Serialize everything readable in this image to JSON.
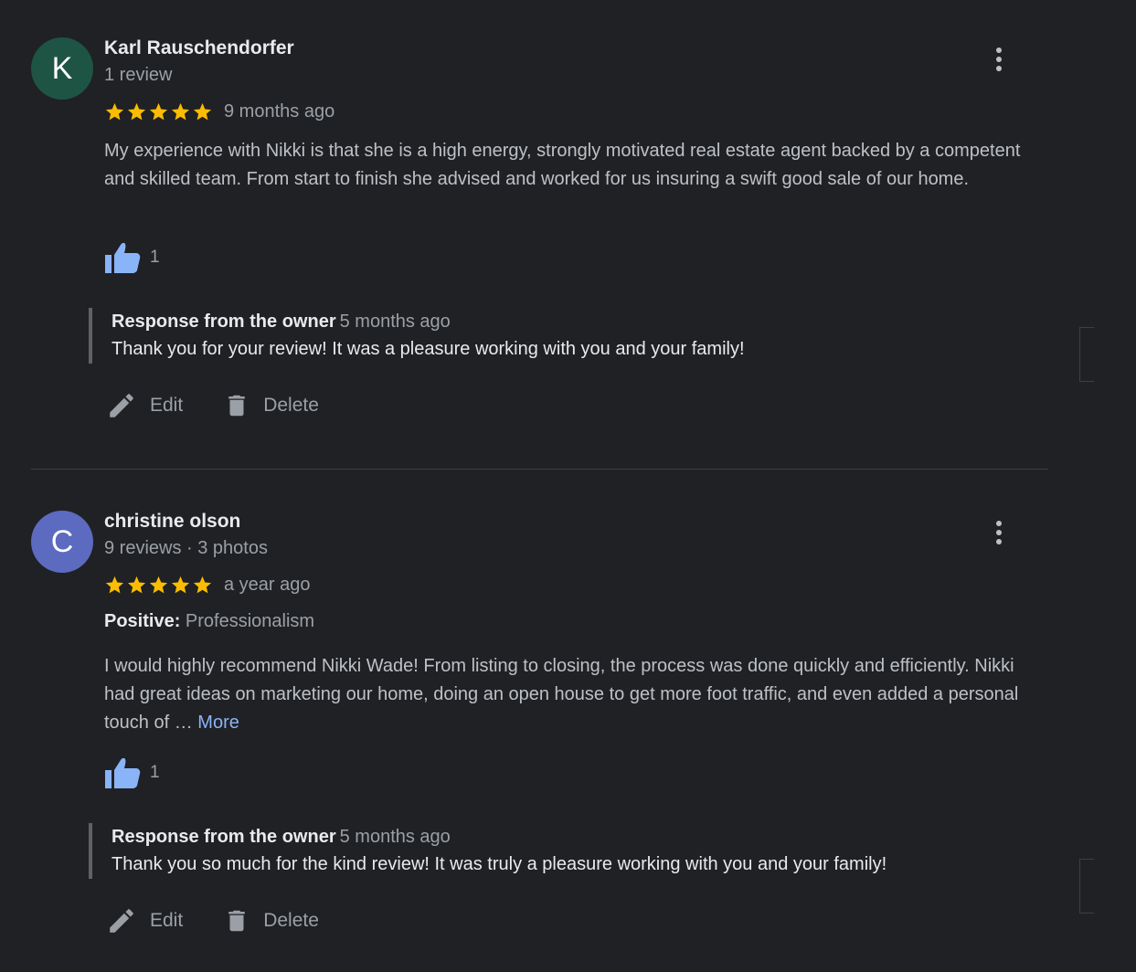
{
  "colors": {
    "background": "#202124",
    "star": "#fbbc04",
    "like": "#8ab4f8",
    "link": "#8ab4f8",
    "avatar_k": "#1e5443",
    "avatar_c": "#5c6bc0"
  },
  "reviews": [
    {
      "avatar_letter": "K",
      "author": "Karl Rauschendorfer",
      "meta": "1 review",
      "rating": 5,
      "time": "9 months ago",
      "body": "My experience with Nikki is that she is a high energy, strongly motivated real estate agent backed by a competent and skilled team. From start to finish she advised and worked for us insuring a swift good sale of our home.",
      "likes": "1",
      "response": {
        "owner_label": "Response from the owner",
        "time": "5 months ago",
        "text": "Thank you for your review! It was a pleasure working with you and your family!"
      },
      "actions": {
        "edit": "Edit",
        "delete": "Delete"
      }
    },
    {
      "avatar_letter": "C",
      "author": "christine olson",
      "meta": "9 reviews · 3 photos",
      "rating": 5,
      "time": "a year ago",
      "attr_label": "Positive:",
      "attr_value": "Professionalism",
      "body": "I would highly recommend Nikki Wade! From listing to closing, the process was done quickly and efficiently. Nikki had great ideas on marketing our home, doing an open house to get more foot traffic, and even added a personal touch of … ",
      "more": "More",
      "likes": "1",
      "response": {
        "owner_label": "Response from the owner",
        "time": "5 months ago",
        "text": "Thank you so much for the kind review! It was truly a pleasure working with you and your family!"
      },
      "actions": {
        "edit": "Edit",
        "delete": "Delete"
      }
    }
  ],
  "icons": {
    "more": "more-vert-icon",
    "star": "star-icon",
    "like": "thumbs-up-icon",
    "edit": "pencil-icon",
    "delete": "trash-icon"
  }
}
